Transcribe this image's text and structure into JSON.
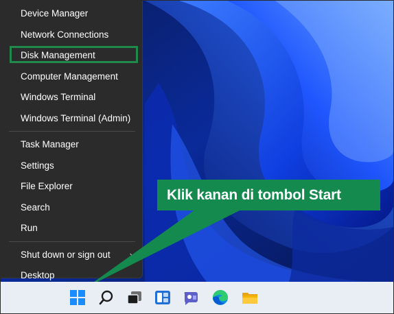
{
  "menu": {
    "items": [
      {
        "label": "Device Manager"
      },
      {
        "label": "Network Connections"
      },
      {
        "label": "Disk Management"
      },
      {
        "label": "Computer Management"
      },
      {
        "label": "Windows Terminal"
      },
      {
        "label": "Windows Terminal (Admin)"
      },
      {
        "label": "Task Manager"
      },
      {
        "label": "Settings"
      },
      {
        "label": "File Explorer"
      },
      {
        "label": "Search"
      },
      {
        "label": "Run"
      },
      {
        "label": "Shut down or sign out",
        "submenu_chevron": "›"
      },
      {
        "label": "Desktop"
      }
    ],
    "highlighted_item": "Disk Management",
    "highlight_color": "#1f8a4c"
  },
  "callout": {
    "text": "Klik kanan di tombol Start",
    "color": "#158a4f"
  },
  "taskbar": {
    "icons": [
      "start-icon",
      "search-icon",
      "task-view-icon",
      "widgets-icon",
      "teams-chat-icon",
      "edge-icon",
      "file-explorer-icon"
    ]
  },
  "colors": {
    "menu_bg": "#2b2b2b",
    "taskbar_bg": "#e9eef5",
    "wallpaper_blue": "#1a4fff"
  }
}
